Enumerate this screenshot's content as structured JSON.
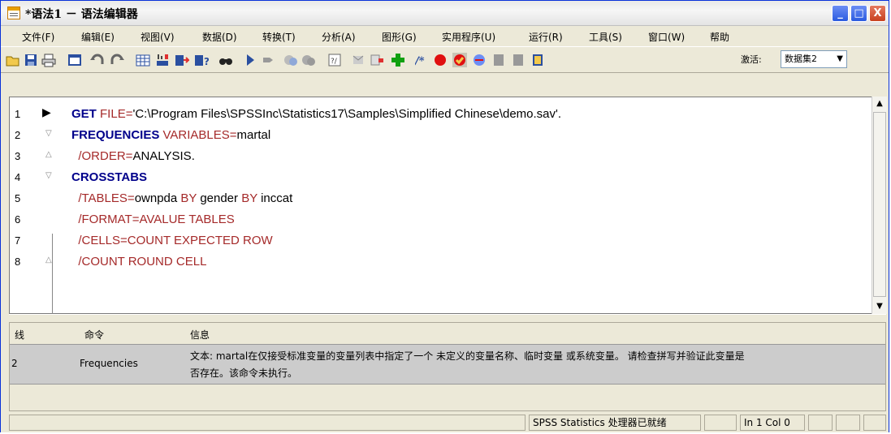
{
  "window": {
    "title": "*语法1 － 语法编辑器",
    "buttons": [
      "_",
      "□",
      "X"
    ]
  },
  "menu": [
    "文件(F)",
    "编辑(E)",
    "视图(V)",
    "数据(D)",
    "转换(T)",
    "分析(A)",
    "图形(G)",
    "实用程序(U)",
    "运行(R)",
    "工具(S)",
    "窗口(W)",
    "帮助"
  ],
  "toolbar": {
    "activate_label": "激活:",
    "dataset_value": "数据集2",
    "icons": [
      "open-icon",
      "save-icon",
      "print-icon",
      "dialog-recall-icon",
      "undo-icon",
      "redo-icon",
      "goto-case-icon",
      "goto-variable-icon",
      "variables-icon",
      "info-icon",
      "find-icon",
      "run-icon",
      "stop-icon",
      "toggle-bookmark-icon",
      "bookmark-icon",
      "syntax-help-icon",
      "comment-icon",
      "uncomment-icon",
      "add-icon",
      "step-icon",
      "breakpoint-icon",
      "clear-breakpoints-icon",
      "blue-icon",
      "gray-icon",
      "gray2-icon",
      "yellow-icon"
    ]
  },
  "editor": {
    "lines": [
      {
        "num": "1",
        "parts": [
          {
            "t": "GET ",
            "c": "kw"
          },
          {
            "t": "FILE=",
            "c": "sub"
          },
          {
            "t": "'C:\\Program Files\\SPSSInc\\Statistics17\\Samples\\Simplified Chinese\\demo.sav'.",
            "c": "txt"
          }
        ]
      },
      {
        "num": "2",
        "parts": [
          {
            "t": "FREQUENCIES ",
            "c": "kw"
          },
          {
            "t": "VARIABLES=",
            "c": "sub"
          },
          {
            "t": "martal",
            "c": "txt"
          }
        ]
      },
      {
        "num": "3",
        "parts": [
          {
            "t": "  /ORDER=",
            "c": "sub"
          },
          {
            "t": "ANALYSIS.",
            "c": "txt"
          }
        ]
      },
      {
        "num": "4",
        "parts": [
          {
            "t": "CROSSTABS",
            "c": "kw"
          }
        ]
      },
      {
        "num": "5",
        "parts": [
          {
            "t": "  /TABLES=",
            "c": "sub"
          },
          {
            "t": "ownpda ",
            "c": "txt"
          },
          {
            "t": "BY ",
            "c": "sub"
          },
          {
            "t": "gender ",
            "c": "txt"
          },
          {
            "t": "BY ",
            "c": "sub"
          },
          {
            "t": "inccat",
            "c": "txt"
          }
        ]
      },
      {
        "num": "6",
        "parts": [
          {
            "t": "  /FORMAT=AVALUE TABLES",
            "c": "sub"
          }
        ]
      },
      {
        "num": "7",
        "parts": [
          {
            "t": "  /CELLS=COUNT EXPECTED ROW",
            "c": "sub"
          }
        ]
      },
      {
        "num": "8",
        "parts": [
          {
            "t": "  /COUNT ROUND CELL",
            "c": "sub"
          }
        ]
      }
    ]
  },
  "errors": {
    "headers": [
      "线",
      "命令",
      "信息"
    ],
    "rows": [
      {
        "line": "2",
        "command": "Frequencies",
        "message1": "文本: martal在仅接受标准变量的变量列表中指定了一个 未定义的变量名称、临时变量 或系统变量。 请检查拼写并验证此变量是",
        "message2": "否存在。该命令未执行。"
      }
    ]
  },
  "status": {
    "processor": "SPSS Statistics  处理器已就绪",
    "position": "In 1 Col 0"
  },
  "colors": {
    "keyword": "#00008b",
    "subcommand": "#a52a2a",
    "title_accent": "#0831d9"
  }
}
